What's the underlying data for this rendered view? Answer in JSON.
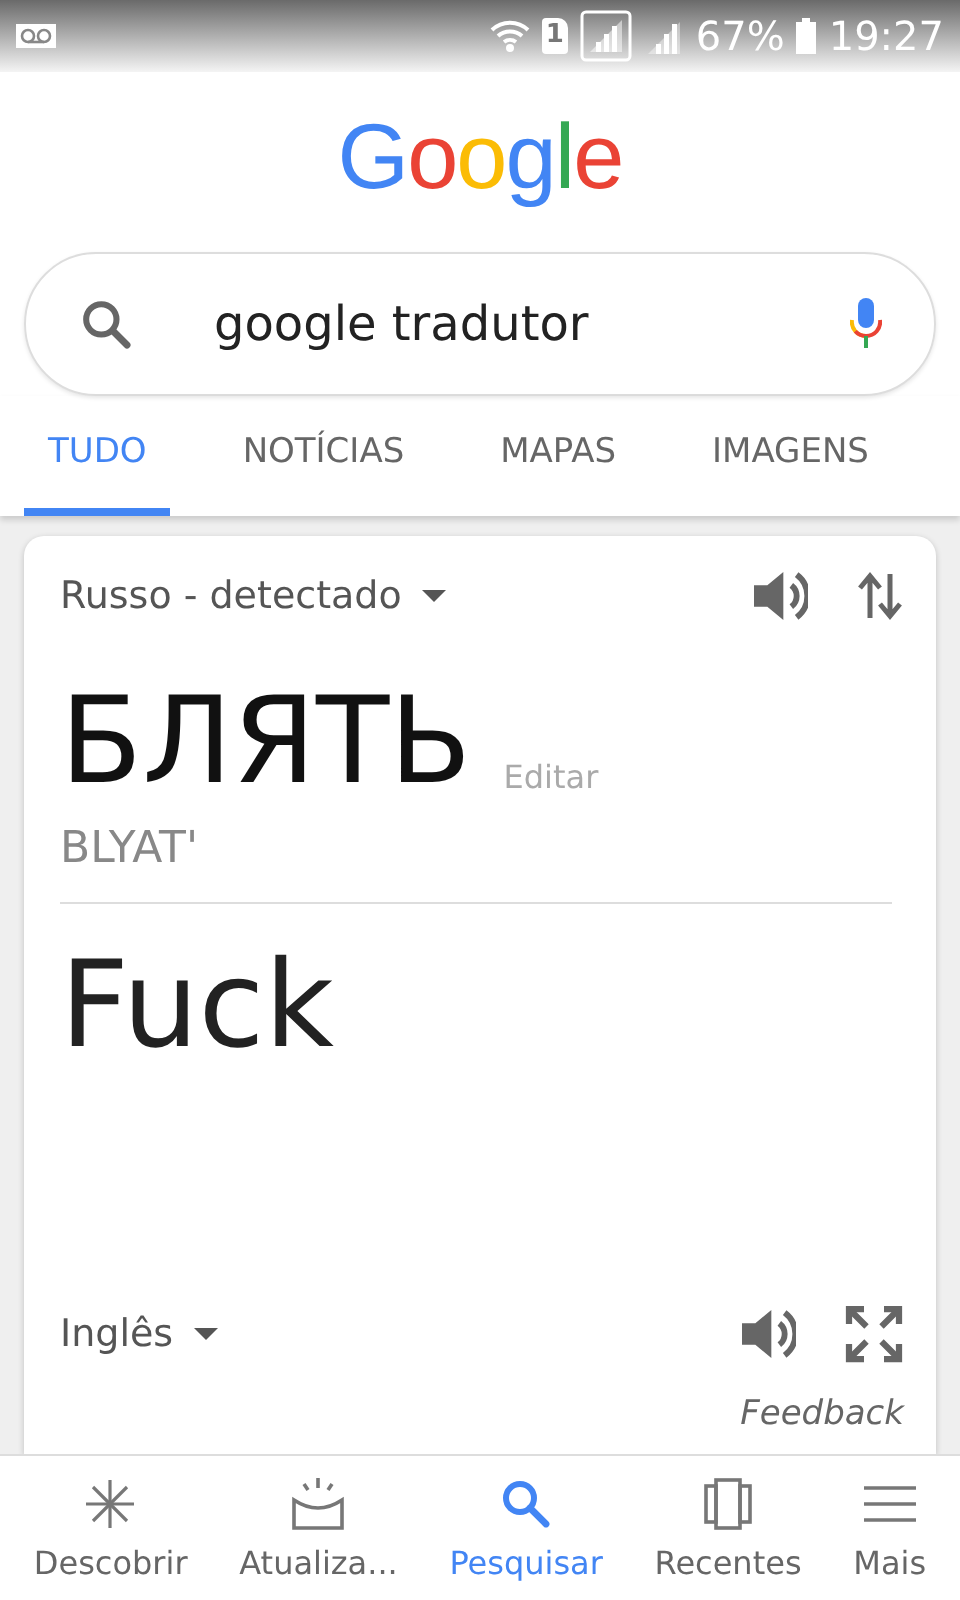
{
  "status_bar": {
    "sim_slot": "1",
    "battery": "67%",
    "time": "19:27"
  },
  "logo": "Google",
  "search": {
    "value": "google tradutor"
  },
  "tabs": [
    {
      "label": "TUDO",
      "selected": true
    },
    {
      "label": "NOTÍCIAS",
      "selected": false
    },
    {
      "label": "MAPAS",
      "selected": false
    },
    {
      "label": "IMAGENS",
      "selected": false
    }
  ],
  "translate_card": {
    "source_language": "Russo - detectado",
    "source_text": "БЛЯТЬ",
    "edit_link": "Editar",
    "transliteration": "BLYAT'",
    "translation": "Fuck",
    "target_language": "Inglês",
    "feedback": "Feedback"
  },
  "bottom_nav": [
    {
      "label": "Descobrir",
      "selected": false
    },
    {
      "label": "Atualiza...",
      "selected": false
    },
    {
      "label": "Pesquisar",
      "selected": true
    },
    {
      "label": "Recentes",
      "selected": false
    },
    {
      "label": "Mais",
      "selected": false
    }
  ]
}
